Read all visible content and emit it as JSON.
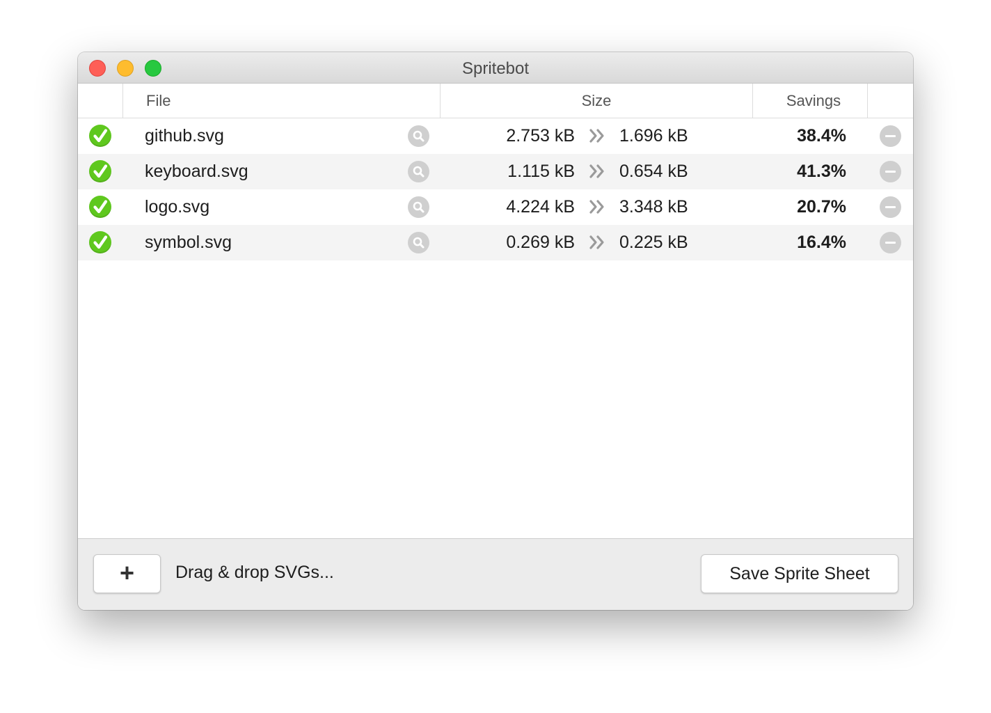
{
  "window": {
    "title": "Spritebot",
    "buttons": [
      "close",
      "minimize",
      "zoom"
    ]
  },
  "table": {
    "columns": {
      "file": "File",
      "size": "Size",
      "savings": "Savings"
    },
    "rows": [
      {
        "status_icon": "check-icon",
        "file": "github.svg",
        "size_before": "2.753 kB",
        "size_after": "1.696 kB",
        "savings": "38.4%"
      },
      {
        "status_icon": "check-icon",
        "file": "keyboard.svg",
        "size_before": "1.115 kB",
        "size_after": "0.654 kB",
        "savings": "41.3%"
      },
      {
        "status_icon": "check-icon",
        "file": "logo.svg",
        "size_before": "4.224 kB",
        "size_after": "3.348 kB",
        "savings": "20.7%"
      },
      {
        "status_icon": "check-icon",
        "file": "symbol.svg",
        "size_before": "0.269 kB",
        "size_after": "0.225 kB",
        "savings": "16.4%"
      }
    ]
  },
  "footer": {
    "add_label": "+",
    "drop_hint": "Drag & drop SVGs...",
    "save_label": "Save Sprite Sheet"
  },
  "colors": {
    "check": "#5fc81e",
    "traffic_close": "#fe5f57",
    "traffic_minimize": "#febc2e",
    "traffic_zoom": "#28c840"
  }
}
